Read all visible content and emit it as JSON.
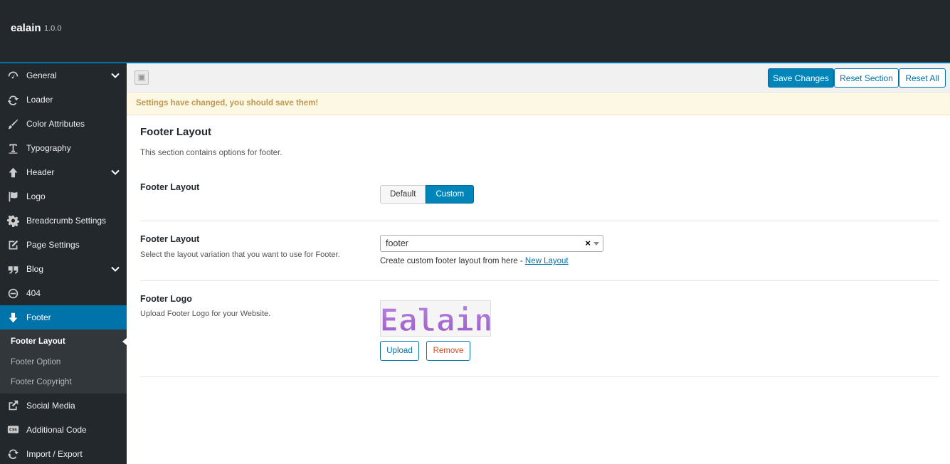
{
  "app": {
    "name": "ealain",
    "version": "1.0.0"
  },
  "sidebar": {
    "items": [
      {
        "label": "General",
        "icon": "gauge-icon",
        "has_children": true
      },
      {
        "label": "Loader",
        "icon": "refresh-icon",
        "has_children": false
      },
      {
        "label": "Color Attributes",
        "icon": "brush-icon",
        "has_children": false
      },
      {
        "label": "Typography",
        "icon": "text-icon",
        "has_children": false
      },
      {
        "label": "Header",
        "icon": "arrow-up-icon",
        "has_children": true
      },
      {
        "label": "Logo",
        "icon": "flag-icon",
        "has_children": false
      },
      {
        "label": "Breadcrumb Settings",
        "icon": "gear-icon",
        "has_children": false
      },
      {
        "label": "Page Settings",
        "icon": "edit-icon",
        "has_children": false
      },
      {
        "label": "Blog",
        "icon": "quote-icon",
        "has_children": true
      },
      {
        "label": "404",
        "icon": "minus-circle-icon",
        "has_children": false
      },
      {
        "label": "Footer",
        "icon": "arrow-down-icon",
        "has_children": false,
        "active": true
      }
    ],
    "footer_sub": [
      "Footer Layout",
      "Footer Option",
      "Footer Copyright"
    ],
    "after": [
      {
        "label": "Social Media",
        "icon": "share-icon"
      },
      {
        "label": "Additional Code",
        "icon": "css-icon"
      },
      {
        "label": "Import / Export",
        "icon": "refresh-icon"
      }
    ]
  },
  "toolbar": {
    "save_label": "Save Changes",
    "reset_section_label": "Reset Section",
    "reset_all_label": "Reset All"
  },
  "notice": "Settings have changed, you should save them!",
  "section": {
    "title": "Footer Layout",
    "description": "This section contains options for footer."
  },
  "fields": {
    "layout_switch": {
      "title": "Footer Layout",
      "options": [
        "Default",
        "Custom"
      ],
      "selected": "Custom"
    },
    "layout_select": {
      "title": "Footer Layout",
      "description": "Select the layout variation that you want to use for Footer.",
      "value": "footer",
      "clear": "×",
      "help_prefix": "Create custom footer layout from here - ",
      "help_link": "New Layout"
    },
    "logo": {
      "title": "Footer Logo",
      "description": "Upload Footer Logo for your Website.",
      "logo_text": "Ealain",
      "upload_label": "Upload",
      "remove_label": "Remove"
    }
  },
  "colors": {
    "admin_dark": "#23282d",
    "accent_blue": "#0073aa",
    "button_blue": "#0085ba",
    "notice_bg": "#fcf8e3",
    "notice_text": "#c09853",
    "logo_purple": "#a36ad0",
    "remove_red": "#d54e21"
  }
}
